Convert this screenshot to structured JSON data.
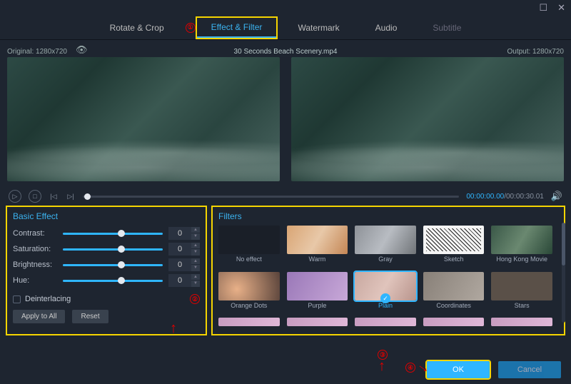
{
  "titlebar": {
    "maximize": "☐",
    "close": "✕"
  },
  "tabs": [
    {
      "label": "Rotate & Crop",
      "active": false
    },
    {
      "label": "Effect & Filter",
      "active": true
    },
    {
      "label": "Watermark",
      "active": false
    },
    {
      "label": "Audio",
      "active": false
    },
    {
      "label": "Subtitle",
      "active": false
    }
  ],
  "info": {
    "original": "Original: 1280x720",
    "filename": "30 Seconds Beach Scenery.mp4",
    "output": "Output: 1280x720"
  },
  "playback": {
    "current": "00:00:00.00",
    "duration": "00:00:30.01"
  },
  "basic_effect": {
    "title": "Basic Effect",
    "rows": [
      {
        "label": "Contrast:",
        "value": "0",
        "knob": 55
      },
      {
        "label": "Saturation:",
        "value": "0",
        "knob": 55
      },
      {
        "label": "Brightness:",
        "value": "0",
        "knob": 55
      },
      {
        "label": "Hue:",
        "value": "0",
        "knob": 55
      }
    ],
    "deinterlacing": "Deinterlacing",
    "apply_all": "Apply to All",
    "reset": "Reset"
  },
  "filters": {
    "title": "Filters",
    "items": [
      {
        "name": "No effect",
        "cls": "t-none"
      },
      {
        "name": "Warm",
        "cls": "t-warm"
      },
      {
        "name": "Gray",
        "cls": "t-gray"
      },
      {
        "name": "Sketch",
        "cls": "t-sketch"
      },
      {
        "name": "Hong Kong Movie",
        "cls": "t-hk"
      },
      {
        "name": "Orange Dots",
        "cls": "t-orange"
      },
      {
        "name": "Purple",
        "cls": "t-purple"
      },
      {
        "name": "Plain",
        "cls": "t-plain",
        "selected": true
      },
      {
        "name": "Coordinates",
        "cls": "t-coord"
      },
      {
        "name": "Stars",
        "cls": "t-stars"
      }
    ]
  },
  "footer": {
    "ok": "OK",
    "cancel": "Cancel"
  },
  "annotations": {
    "n1": "①",
    "n2": "②",
    "n3": "③",
    "n4": "④"
  }
}
